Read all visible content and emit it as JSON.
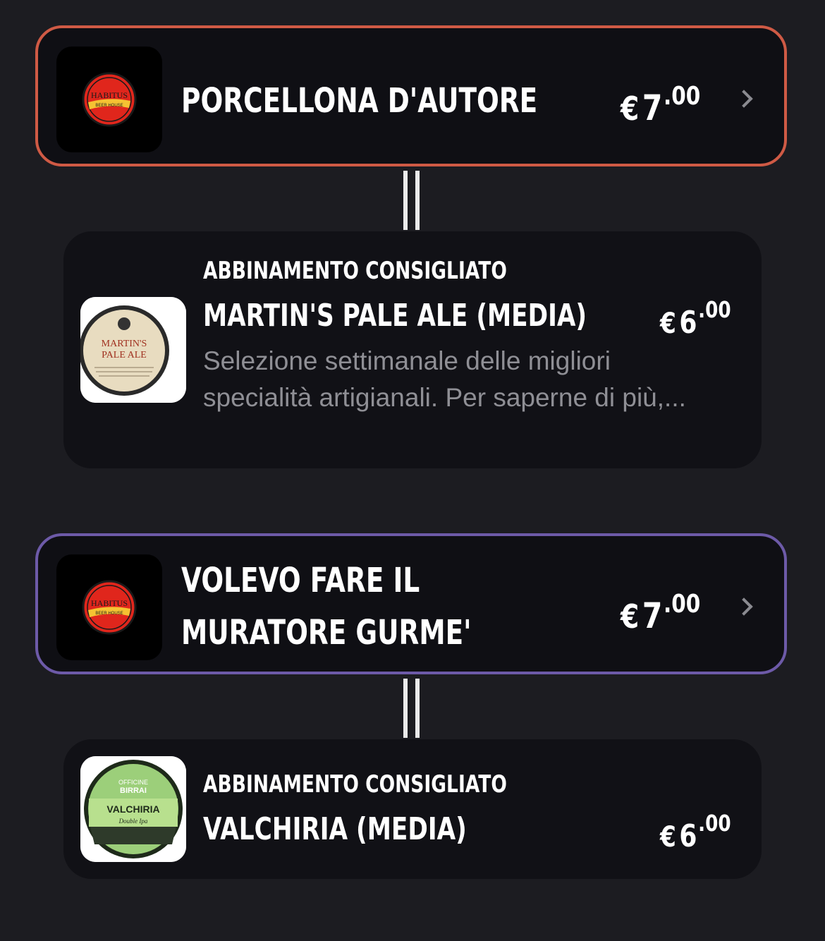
{
  "items": [
    {
      "title": "PORCELLONA D'AUTORE",
      "price_currency": "€",
      "price_int": "7",
      "price_dec": ".00",
      "logo_top": "HABITUS",
      "logo_bottom": "BEER HOUSE",
      "border_color": "#cf5a45",
      "pairing": {
        "label": "ABBINAMENTO CONSIGLIATO",
        "name": "MARTIN'S PALE ALE (MEDIA)",
        "price_currency": "€",
        "price_int": "6",
        "price_dec": ".00",
        "description": "Selezione settimanale delle migliori specialità artigianali. Per saperne di più,...",
        "image_text_1": "MARTIN'S",
        "image_text_2": "PALE ALE"
      }
    },
    {
      "title_line1": "VOLEVO FARE IL",
      "title_line2": "MURATORE GURME'",
      "price_currency": "€",
      "price_int": "7",
      "price_dec": ".00",
      "logo_top": "HABITUS",
      "logo_bottom": "BEER HOUSE",
      "border_color": "#6d5aa8",
      "pairing": {
        "label": "ABBINAMENTO CONSIGLIATO",
        "name": "VALCHIRIA (MEDIA)",
        "price_currency": "€",
        "price_int": "6",
        "price_dec": ".00",
        "image_text_1": "OFFICINE",
        "image_text_2": "BIRRAI",
        "image_text_3": "VALCHIRIA",
        "image_text_4": "Double Ipa"
      }
    }
  ],
  "icons": {
    "chevron": "chevron-right-icon"
  }
}
